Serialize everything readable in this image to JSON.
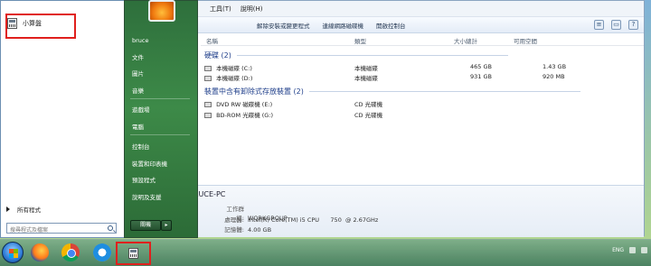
{
  "explorer": {
    "menu": [
      "工具(T)",
      "說明(H)"
    ],
    "toolbar": [
      "解除安裝或變更程式",
      "連線網路磁碟機",
      "開啟控制台"
    ],
    "columns": {
      "name": "名稱",
      "type": "類型",
      "total": "大小總計",
      "free": "可用空間"
    },
    "groups": [
      {
        "title": "硬碟 (2)",
        "items": [
          {
            "name": "本機磁碟 (C:)",
            "type": "本機磁碟",
            "total": "465 GB",
            "free": "1.43 GB"
          },
          {
            "name": "本機磁碟 (D:)",
            "type": "本機磁碟",
            "total": "931 GB",
            "free": "920 MB"
          }
        ]
      },
      {
        "title": "裝置中含有卸除式存放裝置 (2)",
        "items": [
          {
            "name": "DVD RW 磁碟機 (E:)",
            "type": "CD 光碟機"
          },
          {
            "name": "BD-ROM 光碟機 (G:)",
            "type": "CD 光碟機"
          }
        ]
      }
    ],
    "details": {
      "pc_name": "RUCE-PC",
      "workgroup_label": "工作群組:",
      "workgroup": "WORKGROUP",
      "cpu_label": "處理器:",
      "cpu": "Intel(R) Core(TM) i5 CPU      750  @ 2.67GHz",
      "mem_label": "記憶體:",
      "mem": "4.00 GB"
    }
  },
  "start_menu": {
    "pinned_app": "小算盤",
    "all_programs": "所有程式",
    "search_placeholder": "搜尋程式及檔案",
    "right_items": [
      "bruce",
      "文件",
      "圖片",
      "音樂",
      "遊戲場",
      "電腦",
      "控制台",
      "裝置和印表機",
      "預設程式",
      "說明及支援"
    ],
    "shutdown": "關機"
  },
  "taskbar": {
    "tray_lang": "ENG"
  }
}
